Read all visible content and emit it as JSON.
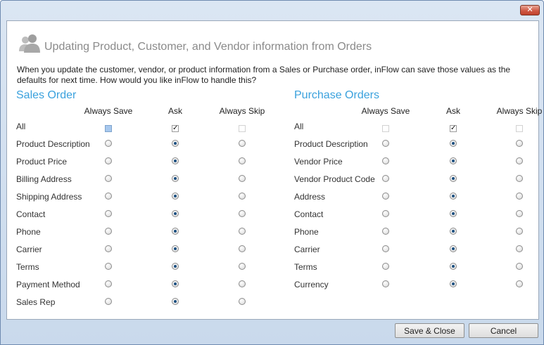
{
  "window": {
    "close_icon": "close-icon",
    "close_glyph": "✕"
  },
  "header": {
    "icon": "users-icon",
    "title": "Updating Product, Customer, and Vendor information from Orders",
    "description": "When you update the customer, vendor, or product information from a Sales or Purchase order, inFlow can save those values as the defaults for next time.  How would you like inFlow to handle this?"
  },
  "columns": [
    "Always Save",
    "Ask",
    "Always Skip"
  ],
  "sales": {
    "title": "Sales Order",
    "all_label": "All",
    "all_state": [
      "partial",
      "checked",
      "disabled"
    ],
    "rows": [
      {
        "label": "Product Description",
        "selected": 1
      },
      {
        "label": "Product Price",
        "selected": 1
      },
      {
        "label": "Billing Address",
        "selected": 1
      },
      {
        "label": "Shipping Address",
        "selected": 1
      },
      {
        "label": "Contact",
        "selected": 1
      },
      {
        "label": "Phone",
        "selected": 1
      },
      {
        "label": "Carrier",
        "selected": 1
      },
      {
        "label": "Terms",
        "selected": 1
      },
      {
        "label": "Payment Method",
        "selected": 1
      },
      {
        "label": "Sales Rep",
        "selected": 1
      }
    ]
  },
  "purchase": {
    "title": "Purchase Orders",
    "all_label": "All",
    "all_state": [
      "disabled",
      "checked",
      "disabled"
    ],
    "rows": [
      {
        "label": "Product Description",
        "selected": 1
      },
      {
        "label": "Vendor Price",
        "selected": 1
      },
      {
        "label": "Vendor Product Code",
        "selected": 1
      },
      {
        "label": "Address",
        "selected": 1
      },
      {
        "label": "Contact",
        "selected": 1
      },
      {
        "label": "Phone",
        "selected": 1
      },
      {
        "label": "Carrier",
        "selected": 1
      },
      {
        "label": "Terms",
        "selected": 1
      },
      {
        "label": "Currency",
        "selected": 1
      }
    ]
  },
  "footer": {
    "save_label": "Save & Close",
    "cancel_label": "Cancel"
  },
  "colors": {
    "accent": "#3aa1dd",
    "radio_dot": "#1b4f80"
  }
}
